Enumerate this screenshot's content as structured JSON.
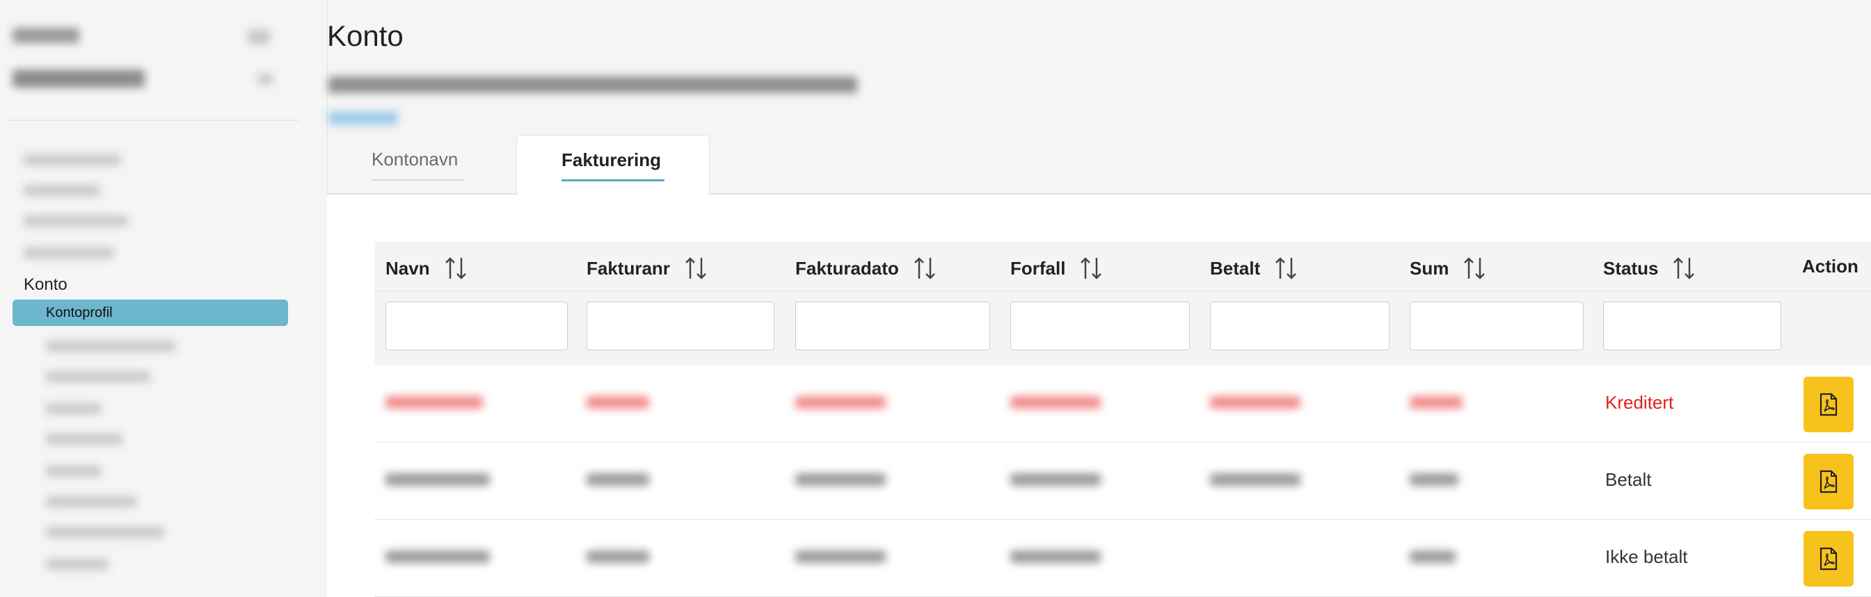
{
  "sidebar": {
    "section_label": "Konto",
    "active_item": "Kontoprofil"
  },
  "main": {
    "title": "Konto",
    "tabs": [
      {
        "label": "Kontonavn",
        "active": false
      },
      {
        "label": "Fakturering",
        "active": true
      }
    ]
  },
  "table": {
    "columns": [
      "Navn",
      "Fakturanr",
      "Fakturadato",
      "Forfall",
      "Betalt",
      "Sum",
      "Status",
      "Action"
    ],
    "rows": [
      {
        "status": "Kreditert",
        "status_color": "#e02020"
      },
      {
        "status": "Betalt",
        "status_color": "#333333"
      },
      {
        "status": "Ikke betalt",
        "status_color": "#333333"
      }
    ]
  },
  "colors": {
    "accent": "#6cb6ce",
    "tab_underline": "#59a9c1",
    "pdf_button": "#f8c21c",
    "credited": "#e02020"
  },
  "icons": {
    "sort": "sort-arrows-icon",
    "pdf": "pdf-file-icon"
  }
}
